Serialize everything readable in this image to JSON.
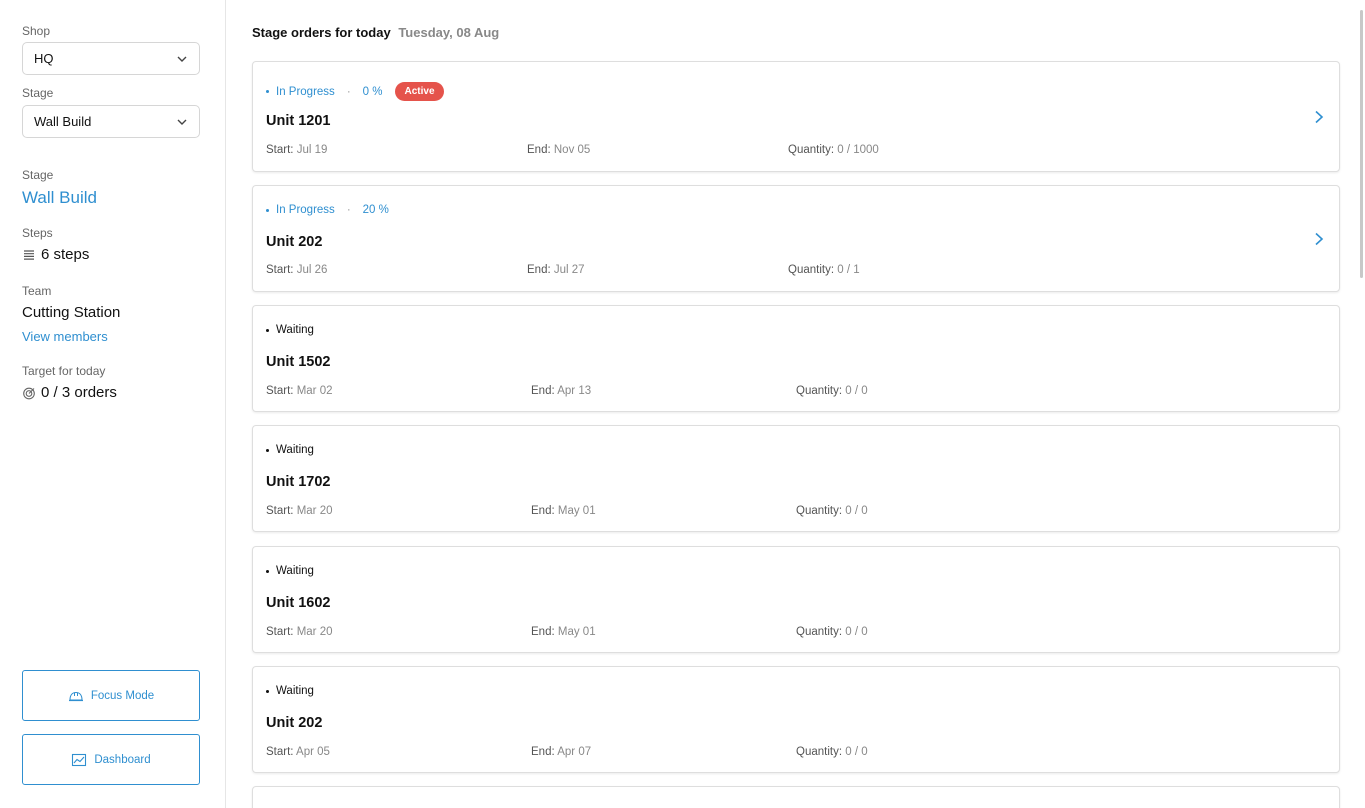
{
  "sidebar": {
    "shop_label": "Shop",
    "shop_value": "HQ",
    "stage_select_label": "Stage",
    "stage_select_value": "Wall Build",
    "stage_label": "Stage",
    "stage_name": "Wall Build",
    "steps_label": "Steps",
    "steps_value": "6 steps",
    "team_label": "Team",
    "team_name": "Cutting Station",
    "view_members": "View members",
    "target_label": "Target for today",
    "target_value": "0 / 3 orders",
    "focus_mode": "Focus Mode",
    "dashboard": "Dashboard"
  },
  "header": {
    "title": "Stage orders for today",
    "date": "Tuesday, 08 Aug"
  },
  "labels": {
    "start": "Start:",
    "end": "End:",
    "quantity": "Quantity:"
  },
  "colors": {
    "accent": "#2f8fd0",
    "active_badge": "#e5534b"
  },
  "orders": [
    {
      "status": "In Progress",
      "progress": "0 %",
      "badge": "Active",
      "title": "Unit 1201",
      "start": "Jul 19",
      "end": "Nov 05",
      "quantity": "0 / 1000"
    },
    {
      "status": "In Progress",
      "progress": "20 %",
      "title": "Unit 202",
      "start": "Jul 26",
      "end": "Jul 27",
      "quantity": "0 / 1"
    },
    {
      "status": "Waiting",
      "title": "Unit 1502",
      "start": "Mar 02",
      "end": "Apr 13",
      "quantity": "0 / 0"
    },
    {
      "status": "Waiting",
      "title": "Unit 1702",
      "start": "Mar 20",
      "end": "May 01",
      "quantity": "0 / 0"
    },
    {
      "status": "Waiting",
      "title": "Unit 1602",
      "start": "Mar 20",
      "end": "May 01",
      "quantity": "0 / 0"
    },
    {
      "status": "Waiting",
      "title": "Unit 202",
      "start": "Apr 05",
      "end": "Apr 07",
      "quantity": "0 / 0"
    }
  ]
}
